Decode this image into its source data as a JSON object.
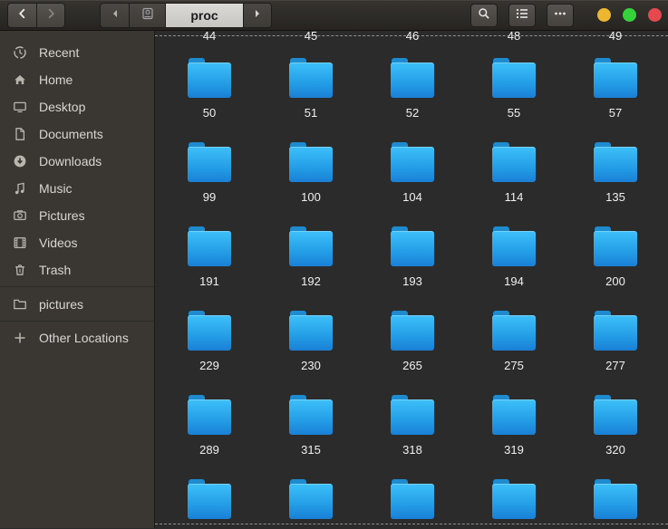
{
  "toolbar": {
    "path": {
      "current": "proc"
    },
    "icons": {
      "back": "chevron-left-icon",
      "forward": "chevron-right-icon",
      "path_scroll_left": "triangle-left-icon",
      "drive": "drive-icon",
      "path_scroll_right": "triangle-right-icon",
      "search": "search-icon",
      "list_view": "list-view-icon",
      "menu": "ellipsis-icon"
    }
  },
  "window_controls": {
    "minimize_color": "#edb631",
    "maximize_color": "#35d23c",
    "close_color": "#e3494f"
  },
  "sidebar": {
    "items": [
      {
        "label": "Recent",
        "icon": "recent-icon"
      },
      {
        "label": "Home",
        "icon": "home-icon"
      },
      {
        "label": "Desktop",
        "icon": "desktop-icon"
      },
      {
        "label": "Documents",
        "icon": "documents-icon"
      },
      {
        "label": "Downloads",
        "icon": "downloads-icon"
      },
      {
        "label": "Music",
        "icon": "music-icon"
      },
      {
        "label": "Pictures",
        "icon": "pictures-icon"
      },
      {
        "label": "Videos",
        "icon": "videos-icon"
      },
      {
        "label": "Trash",
        "icon": "trash-icon"
      }
    ],
    "bookmarks": [
      {
        "label": "pictures",
        "icon": "folder-icon"
      }
    ],
    "other_locations": {
      "label": "Other Locations",
      "icon": "plus-icon"
    }
  },
  "content": {
    "view": "icon-grid",
    "top_partial_labels": [
      "44",
      "45",
      "46",
      "48",
      "49"
    ],
    "rows": [
      [
        "50",
        "51",
        "52",
        "55",
        "57"
      ],
      [
        "99",
        "100",
        "104",
        "114",
        "135"
      ],
      [
        "191",
        "192",
        "193",
        "194",
        "200"
      ],
      [
        "229",
        "230",
        "265",
        "275",
        "277"
      ],
      [
        "289",
        "315",
        "318",
        "319",
        "320"
      ]
    ],
    "bottom_partial_row_count": 5,
    "folder_colors": {
      "top": "#3ec0f9",
      "mid": "#25a0e8",
      "bottom": "#1a80d5",
      "tab": "#1e8bd0"
    }
  }
}
